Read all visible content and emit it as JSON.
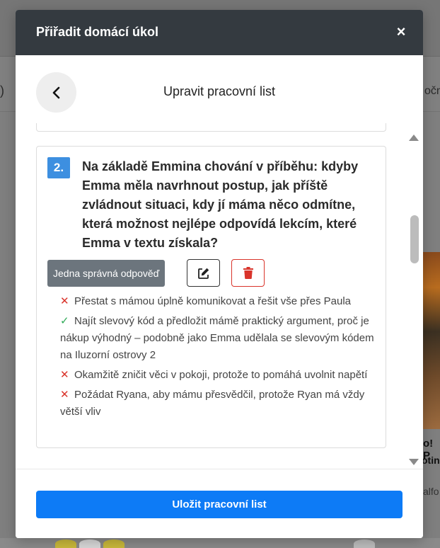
{
  "background": {
    "left_fragment": ")",
    "right_fragment": "očn",
    "card_title_fragment": "o! P",
    "card_sub_fragment": "otin",
    "card_meta_fragment": "alfo"
  },
  "modal": {
    "title": "Přiřadit domácí úkol",
    "close_symbol": "×",
    "subheader_title": "Upravit pracovní list"
  },
  "question": {
    "number": "2.",
    "text": "Na základě Emmina chování v příběhu: kdyby Emma měla navrhnout postup, jak příště zvládnout situaci, kdy jí máma něco odmítne, která možnost nejlépe odpovídá lekcím, které Emma v textu získala?",
    "type_label": "Jedna správná odpověď",
    "answers": [
      {
        "mark": "✕",
        "correct": false,
        "text": "Přestat s mámou úplně komunikovat a řešit vše přes Paula"
      },
      {
        "mark": "✓",
        "correct": true,
        "text": "Najít slevový kód a předložit mámě praktický argument, proč je nákup výhodný – podobně jako Emma udělala se slevovým kódem na Iluzorní ostrovy 2"
      },
      {
        "mark": "✕",
        "correct": false,
        "text": "Okamžitě zničit věci v pokoji, protože to pomáhá uvolnit napětí"
      },
      {
        "mark": "✕",
        "correct": false,
        "text": "Požádat Ryana, aby mámu přesvědčil, protože Ryan má vždy větší vliv"
      }
    ]
  },
  "footer": {
    "save_label": "Uložit pracovní list"
  },
  "colors": {
    "header_bg": "#343a40",
    "primary": "#0d7bf6",
    "badge": "#3d8fe0",
    "danger": "#d9342b",
    "success": "#2faa57"
  }
}
